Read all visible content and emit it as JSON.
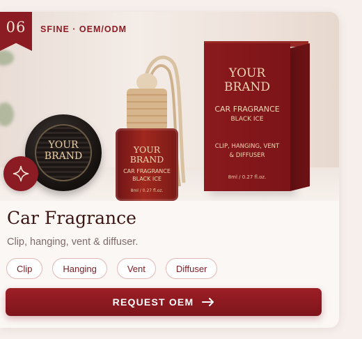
{
  "badge": {
    "number": "06"
  },
  "brand_tag": "SFINE · OEM/ODM",
  "hero": {
    "vent_clip_text": "YOUR\nBRAND",
    "bottle": {
      "brand": "YOUR\nBRAND",
      "line1": "CAR FRAGRANCE",
      "line2": "BLACK ICE",
      "volume": "8ml / 0.27 fl.oz."
    },
    "box": {
      "brand": "YOUR\nBRAND",
      "line1": "CAR FRAGRANCE",
      "line2": "BLACK ICE",
      "features": "CLIP, HANGING, VENT\n& DIFFUSER",
      "volume": "8ml / 0.27 fl.oz."
    }
  },
  "product": {
    "title": "Car Fragrance",
    "description": "Clip, hanging, vent & diffuser.",
    "tags": [
      "Clip",
      "Hanging",
      "Vent",
      "Diffuser"
    ]
  },
  "cta": {
    "label": "REQUEST OEM",
    "icon": "arrow-right-icon"
  },
  "colors": {
    "accent": "#8c1c24",
    "background": "#f6efec"
  }
}
